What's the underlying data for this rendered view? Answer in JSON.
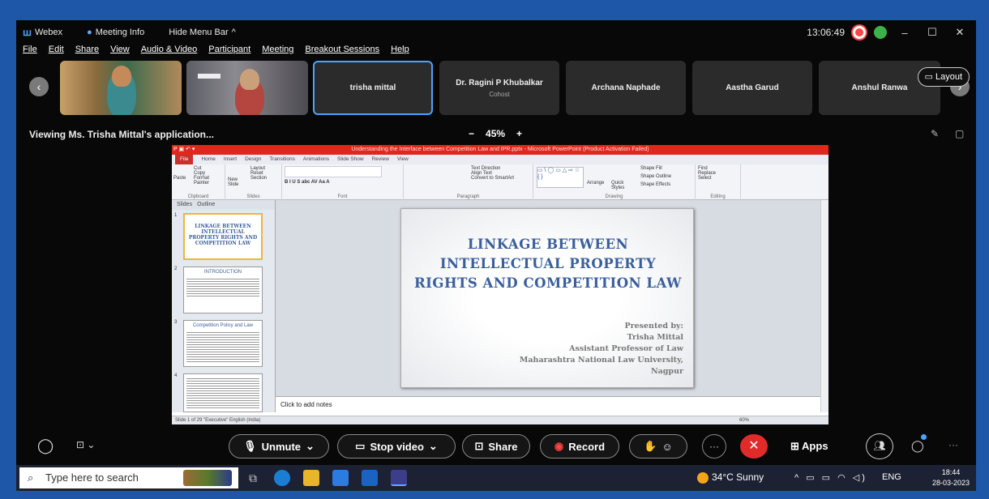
{
  "topbar": {
    "app": "Webex",
    "meeting_info": "Meeting Info",
    "hide_menu": "Hide Menu Bar",
    "chevron": "^",
    "time": "13:06:49"
  },
  "menu": [
    "File",
    "Edit",
    "Share",
    "View",
    "Audio & Video",
    "Participant",
    "Meeting",
    "Breakout Sessions",
    "Help"
  ],
  "participants": [
    {
      "name": "trisha mittal",
      "sub": ""
    },
    {
      "name": "Dr. Ragini P Khubalkar",
      "sub": "Cohost"
    },
    {
      "name": "Archana Naphade",
      "sub": ""
    },
    {
      "name": "Aastha Garud",
      "sub": ""
    },
    {
      "name": "Anshul Ranwa",
      "sub": ""
    }
  ],
  "layout_label": "Layout",
  "viewing": "Viewing Ms. Trisha Mittal's application...",
  "zoom": {
    "minus": "−",
    "value": "45%",
    "plus": "+"
  },
  "ppt": {
    "title": "Understanding the Interface between Competition Law and IPR.pptx - Microsoft PowerPoint (Product Activation Failed)",
    "tabs": [
      "File",
      "Home",
      "Insert",
      "Design",
      "Transitions",
      "Animations",
      "Slide Show",
      "Review",
      "View"
    ],
    "groups": [
      {
        "label": "Clipboard",
        "items": [
          "Cut",
          "Copy",
          "Format Painter",
          "Paste"
        ]
      },
      {
        "label": "Slides",
        "items": [
          "Layout",
          "Reset",
          "New Slide",
          "Section"
        ]
      },
      {
        "label": "Font",
        "items": [
          "B I U S abc AV Aa A"
        ]
      },
      {
        "label": "Paragraph",
        "items": [
          "Text Direction",
          "Align Text",
          "Convert to SmartArt"
        ]
      },
      {
        "label": "Drawing",
        "items": [
          "Arrange",
          "Quick Styles",
          "Shape Fill",
          "Shape Outline",
          "Shape Effects"
        ]
      },
      {
        "label": "Editing",
        "items": [
          "Find",
          "Replace",
          "Select"
        ]
      }
    ],
    "panel_tabs": [
      "Slides",
      "Outline"
    ],
    "thumbs": [
      {
        "num": "1",
        "title": "LINKAGE BETWEEN INTELLECTUAL PROPERTY RIGHTS AND COMPETITION LAW"
      },
      {
        "num": "2",
        "title": "INTRODUCTION"
      },
      {
        "num": "3",
        "title": "Competition Policy and Law"
      },
      {
        "num": "4",
        "title": ""
      }
    ],
    "slide_title": "LINKAGE BETWEEN INTELLECTUAL PROPERTY RIGHTS AND COMPETITION LAW",
    "presenter": [
      "Presented by:",
      "Trisha Mittal",
      "Assistant Professor of Law",
      "Maharashtra National Law University,",
      "Nagpur"
    ],
    "notes": "Click to add notes",
    "status": "Slide 1 of 29   \"Executive\"   English (India)",
    "zoom_status": "60%"
  },
  "controls": {
    "unmute": "Unmute",
    "stop_video": "Stop video",
    "share": "Share",
    "record": "Record",
    "apps": "Apps"
  },
  "taskbar": {
    "search_placeholder": "Type here to search",
    "weather": "34°C  Sunny",
    "lang": "ENG",
    "time": "18:44",
    "date": "28-03-2023"
  }
}
